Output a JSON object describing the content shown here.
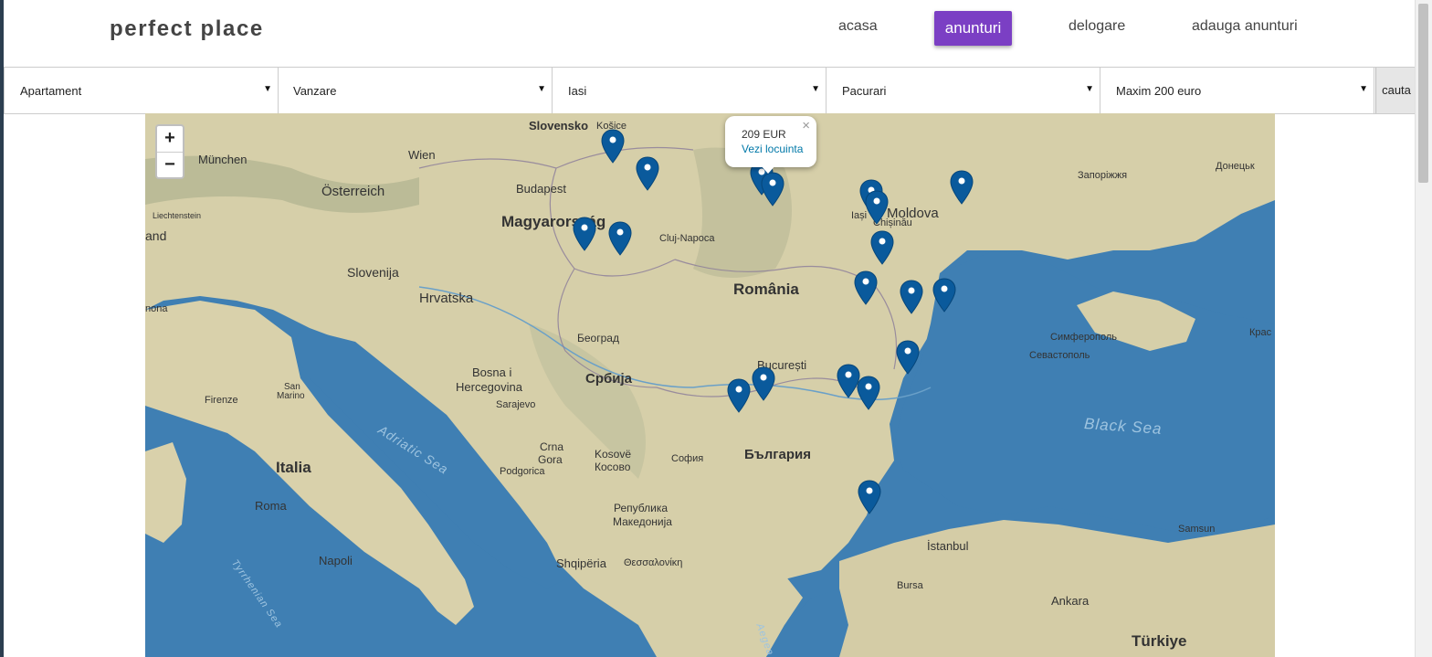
{
  "header": {
    "brand": "perfect place",
    "nav": [
      {
        "label": "acasa"
      },
      {
        "label": "anunturi"
      },
      {
        "label": "delogare"
      },
      {
        "label": "adauga anunturi"
      }
    ]
  },
  "filters": {
    "property_type": "Apartament",
    "transaction": "Vanzare",
    "city": "Iasi",
    "neighborhood": "Pacurari",
    "price": "Maxim 200 euro",
    "search_label": "cauta"
  },
  "map": {
    "zoom_in": "+",
    "zoom_out": "−",
    "popup": {
      "price": "209 EUR",
      "link": "Vezi locuinta",
      "close": "×"
    },
    "labels": {
      "slovensko": "Slovensko",
      "kosice": "Košice",
      "wien": "Wien",
      "munchen": "München",
      "osterreich": "Österreich",
      "budapest": "Budapest",
      "magyarorszag": "Magyarország",
      "cluj": "Cluj-Napoca",
      "liechtenstein": "Liechtenstein",
      "and": "and",
      "slovenija": "Slovenija",
      "hrvatska": "Hrvatska",
      "romania": "România",
      "iasi": "Iași",
      "moldova": "Moldova",
      "chisinau": "Chișinău",
      "zaporizhzhia": "Запоріжжя",
      "donetsk": "Донецьк",
      "beograd": "Београд",
      "srbija": "Србија",
      "bucuresti": "București",
      "bosna": "Bosna i",
      "hercegovina": "Hercegovina",
      "sarajevo": "Sarajevo",
      "firenze": "Firenze",
      "sanmarino1": "San",
      "sanmarino2": "Marino",
      "adriatic": "Adriatic Sea",
      "italia": "Italia",
      "roma": "Roma",
      "crna": "Crna",
      "gora": "Gora",
      "podgorica": "Podgorica",
      "kosove": "Kosovë",
      "kosovo": "Косово",
      "sofia": "София",
      "bulgaria": "България",
      "makedonija1": "Република",
      "makedonija2": "Македонија",
      "shqiperia": "Shqipëria",
      "thessaloniki": "Θεσσαλονίκη",
      "napoli": "Napoli",
      "tyrrhenian": "Tyrrhenian Sea",
      "simferopol": "Симферополь",
      "sevastopol": "Севастополь",
      "blacksea": "Black Sea",
      "krasnodar": "Крас",
      "samsun": "Samsun",
      "istanbul": "İstanbul",
      "bursa": "Bursa",
      "ankara": "Ankara",
      "turkiye": "Türkiye",
      "aegean": "Aegea",
      "ancona": "nona"
    },
    "marker_color": "#0a5a9c"
  }
}
